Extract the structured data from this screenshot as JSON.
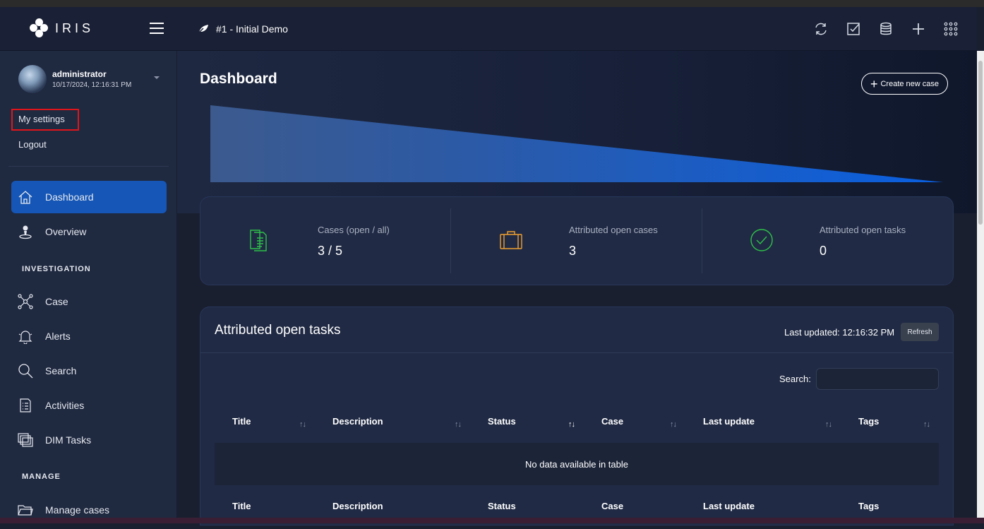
{
  "app": {
    "logo_text": "IRIS",
    "case_title": "#1 - Initial Demo"
  },
  "user": {
    "name": "administrator",
    "timestamp": "10/17/2024, 12:16:31 PM",
    "my_settings": "My settings",
    "logout": "Logout"
  },
  "sidebar": {
    "items": [
      {
        "label": "Dashboard",
        "icon": "home-icon",
        "active": true
      },
      {
        "label": "Overview",
        "icon": "map-pin-icon"
      },
      {
        "label": "Case",
        "icon": "network-icon"
      },
      {
        "label": "Alerts",
        "icon": "bell-icon"
      },
      {
        "label": "Search",
        "icon": "search-icon"
      },
      {
        "label": "Activities",
        "icon": "clipboard-icon"
      },
      {
        "label": "DIM Tasks",
        "icon": "copy-icon"
      },
      {
        "label": "Manage cases",
        "icon": "folder-icon"
      }
    ],
    "sections": {
      "investigation": "INVESTIGATION",
      "manage": "MANAGE"
    }
  },
  "dashboard": {
    "title": "Dashboard",
    "create_button": "Create new case",
    "stats": [
      {
        "label": "Cases (open / all)",
        "value": "3 / 5",
        "icon": "document-icon",
        "color": "#2ec24a"
      },
      {
        "label": "Attributed open cases",
        "value": "3",
        "icon": "briefcase-icon",
        "color": "#f0a030"
      },
      {
        "label": "Attributed open tasks",
        "value": "0",
        "icon": "check-circle-icon",
        "color": "#2ec24a"
      }
    ]
  },
  "tasks": {
    "title": "Attributed open tasks",
    "last_updated": "Last updated: 12:16:32 PM",
    "refresh": "Refresh",
    "search_label": "Search:",
    "columns": [
      "Title",
      "Description",
      "Status",
      "Case",
      "Last update",
      "Tags"
    ],
    "empty": "No data available in table"
  },
  "colors": {
    "accent": "#1556b6",
    "highlight": "#e0151b"
  }
}
